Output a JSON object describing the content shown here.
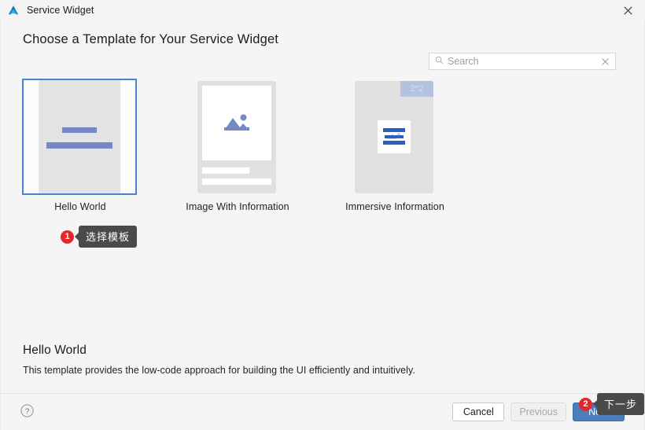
{
  "window": {
    "title": "Service Widget",
    "app_icon": "mountain-logo-icon",
    "close_label": "×"
  },
  "header": {
    "page_title": "Choose a Template for Your Service Widget"
  },
  "search": {
    "placeholder": "Search",
    "value": "",
    "icon": "search-icon",
    "clear_icon": "clear-icon"
  },
  "templates": [
    {
      "id": "hello-world",
      "label": "Hello World",
      "selected": true,
      "badge": ""
    },
    {
      "id": "image-with-information",
      "label": "Image With Information",
      "selected": false,
      "badge": ""
    },
    {
      "id": "immersive-information",
      "label": "Immersive Information",
      "selected": false,
      "badge": "2*2"
    }
  ],
  "annotations": [
    {
      "number": "1",
      "text": "选择模板"
    },
    {
      "number": "2",
      "text": "下一步"
    }
  ],
  "detail": {
    "title": "Hello World",
    "description": "This template provides the low-code approach for building the UI efficiently and intuitively."
  },
  "footer": {
    "help_icon": "help-icon",
    "cancel_label": "Cancel",
    "previous_label": "Previous",
    "next_label": "Next"
  },
  "colors": {
    "accent_blue": "#4a7ebb",
    "selection_border": "#4a84d0",
    "template_bar_blue": "#7289c4",
    "annotation_red": "#e8262a",
    "tooltip_gray": "#4a4a4a"
  }
}
